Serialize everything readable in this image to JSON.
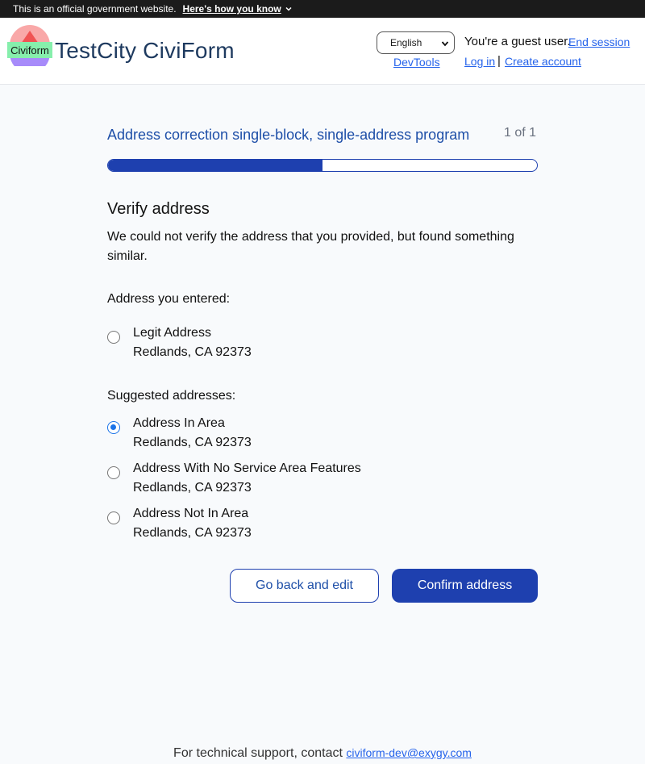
{
  "gov_banner": {
    "text": "This is an official government website.",
    "how_link": "Here's how you know"
  },
  "header": {
    "logo_text": "Civiform",
    "app_title": "TestCity CiviForm",
    "language": "English",
    "devtools": "DevTools",
    "guest_text": "You're a guest user.",
    "end_session": "End session",
    "login": "Log in",
    "separator": "|",
    "create_account": "Create account"
  },
  "program": {
    "title": "Address correction single-block, single-address program",
    "step_count": "1 of 1",
    "progress_fraction": 0.5
  },
  "verify": {
    "heading": "Verify address",
    "description": "We could not verify the address that you provided, but found something similar.",
    "entered_label": "Address you entered:",
    "entered": {
      "line1": "Legit Address",
      "line2": "Redlands, CA 92373",
      "checked": false
    },
    "suggested_label": "Suggested addresses:",
    "suggestions": [
      {
        "line1": "Address In Area",
        "line2": "Redlands, CA 92373",
        "checked": true
      },
      {
        "line1": "Address With No Service Area Features",
        "line2": "Redlands, CA 92373",
        "checked": false
      },
      {
        "line1": "Address Not In Area",
        "line2": "Redlands, CA 92373",
        "checked": false
      }
    ]
  },
  "actions": {
    "back": "Go back and edit",
    "confirm": "Confirm address"
  },
  "footer": {
    "text": "For technical support, contact",
    "email": "civiform-dev@exygy.com"
  },
  "colors": {
    "primary": "#1e40af",
    "link": "#2563eb",
    "banner_bg": "#1b1b1b"
  }
}
